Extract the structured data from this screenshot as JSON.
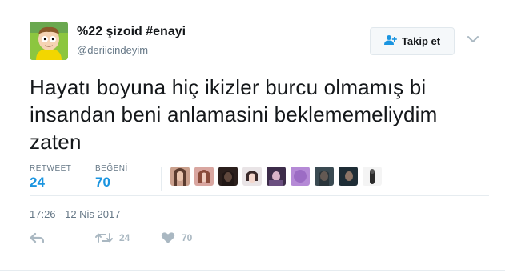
{
  "user": {
    "display_name": "%22 şizoid #enayi",
    "handle": "@deriicindeyim",
    "avatar_icon": "cartoon-character-avatar"
  },
  "follow_button": {
    "label": "Takip et",
    "icon": "add-user-icon"
  },
  "tweet": {
    "text": "Hayatı boyuna hiç ikizler burcu olmamış bi insandan beni anlamasini beklememeliydim zaten"
  },
  "stats": {
    "retweet_label": "RETWEET",
    "retweet_count": "24",
    "likes_label": "BEĞENİ",
    "likes_count": "70",
    "likers_count": 9
  },
  "timestamp": "17:26 - 12 Nis 2017",
  "actions": {
    "reply_icon": "reply-icon",
    "retweet_icon": "retweet-icon",
    "retweet_count": "24",
    "like_icon": "heart-icon",
    "like_count": "70"
  },
  "colors": {
    "accent": "#1b95e0",
    "muted": "#657786",
    "icon_gray": "#aab8c2",
    "border": "#e6ecf0"
  }
}
